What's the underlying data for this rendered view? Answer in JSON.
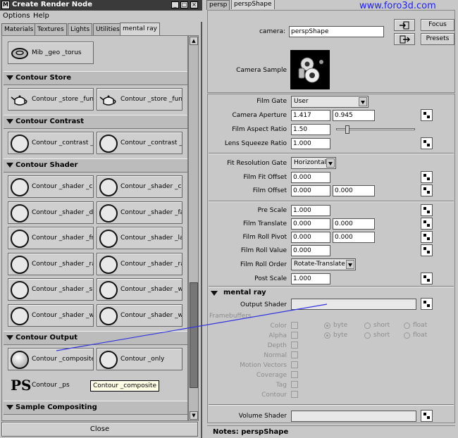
{
  "left_window": {
    "title": "Create Render Node",
    "title_icon": "M",
    "window_buttons": [
      "_",
      "□",
      "×"
    ],
    "menu": [
      "Options",
      "Help"
    ],
    "tabs": [
      "Materials",
      "Textures",
      "Lights",
      "Utilities",
      "mental ray"
    ],
    "active_tab": "mental ray",
    "partial_node": "Mib _geo _torus",
    "sections": [
      {
        "label": "Contour Store",
        "nodes": [
          "Contour _store _func",
          "Contour _store _func"
        ]
      },
      {
        "label": "Contour Contrast",
        "nodes": [
          "Contour _contrast _fu",
          "Contour _contrast _fu"
        ]
      },
      {
        "label": "Contour Shader",
        "nodes": [
          "Contour _shader _co",
          "Contour _shader _cu",
          "Contour _shader _de",
          "Contour _shader _fac",
          "Contour _shader _fra",
          "Contour _shader _lay",
          "Contour _shader _ran",
          "Contour _shader _ran",
          "Contour _shader _sin",
          "Contour _shader _wi",
          "Contour _shader _wi",
          "Contour _shader _wi"
        ]
      },
      {
        "label": "Contour Output",
        "nodes": [
          "Contour _composite",
          "Contour _only",
          "Contour _ps"
        ]
      },
      {
        "label": "Sample Compositing",
        "nodes": []
      }
    ],
    "ps_icon_text": "PS",
    "tooltip": "Contour _composite",
    "close_label": "Close"
  },
  "right_window": {
    "tabs": [
      "persp",
      "perspShape"
    ],
    "active_tab": "perspShape",
    "watermark": "www.foro3d.com",
    "camera_label": "camera:",
    "camera_value": "perspShape",
    "focus_label": "Focus",
    "presets_label": "Presets",
    "camera_sample_label": "Camera Sample",
    "film": {
      "film_gate_label": "Film Gate",
      "film_gate_value": "User",
      "aperture_label": "Camera Aperture",
      "aperture_x": "1.417",
      "aperture_y": "0.945",
      "aspect_label": "Film Aspect Ratio",
      "aspect_value": "1.50",
      "aspect_slider": 0.12,
      "squeeze_label": "Lens Squeeze Ratio",
      "squeeze_value": "1.000"
    },
    "fit": {
      "gate_label": "Fit Resolution Gate",
      "gate_value": "Horizontal",
      "fit_offset_label": "Film Fit Offset",
      "fit_offset_value": "0.000",
      "offset_label": "Film Offset",
      "offset_x": "0.000",
      "offset_y": "0.000"
    },
    "transform": {
      "prescale_label": "Pre Scale",
      "prescale_value": "1.000",
      "translate_label": "Film Translate",
      "translate_x": "0.000",
      "translate_y": "0.000",
      "pivot_label": "Film Roll Pivot",
      "pivot_x": "0.000",
      "pivot_y": "0.000",
      "roll_value_label": "Film Roll Value",
      "roll_value": "0.000",
      "roll_order_label": "Film Roll Order",
      "roll_order_value": "Rotate-Translate",
      "postscale_label": "Post Scale",
      "postscale_value": "1.000"
    },
    "mental_ray": {
      "header": "mental ray",
      "output_shader_label": "Output Shader",
      "framebuffers_label": "Framebuffers",
      "fb_items": [
        "Color",
        "Alpha",
        "Depth",
        "Normal",
        "Motion Vectors",
        "Coverage",
        "Tag",
        "Contour"
      ],
      "radio_row1": [
        "byte",
        "short",
        "float"
      ],
      "radio_row2": [
        "byte",
        "short",
        "float"
      ],
      "volume_shader_label": "Volume Shader"
    },
    "notes_label": "Notes: perspShape"
  },
  "colors": {
    "connector": "#3333dd",
    "watermark": "#2222ee",
    "titlebar": "#3a3a3a"
  }
}
